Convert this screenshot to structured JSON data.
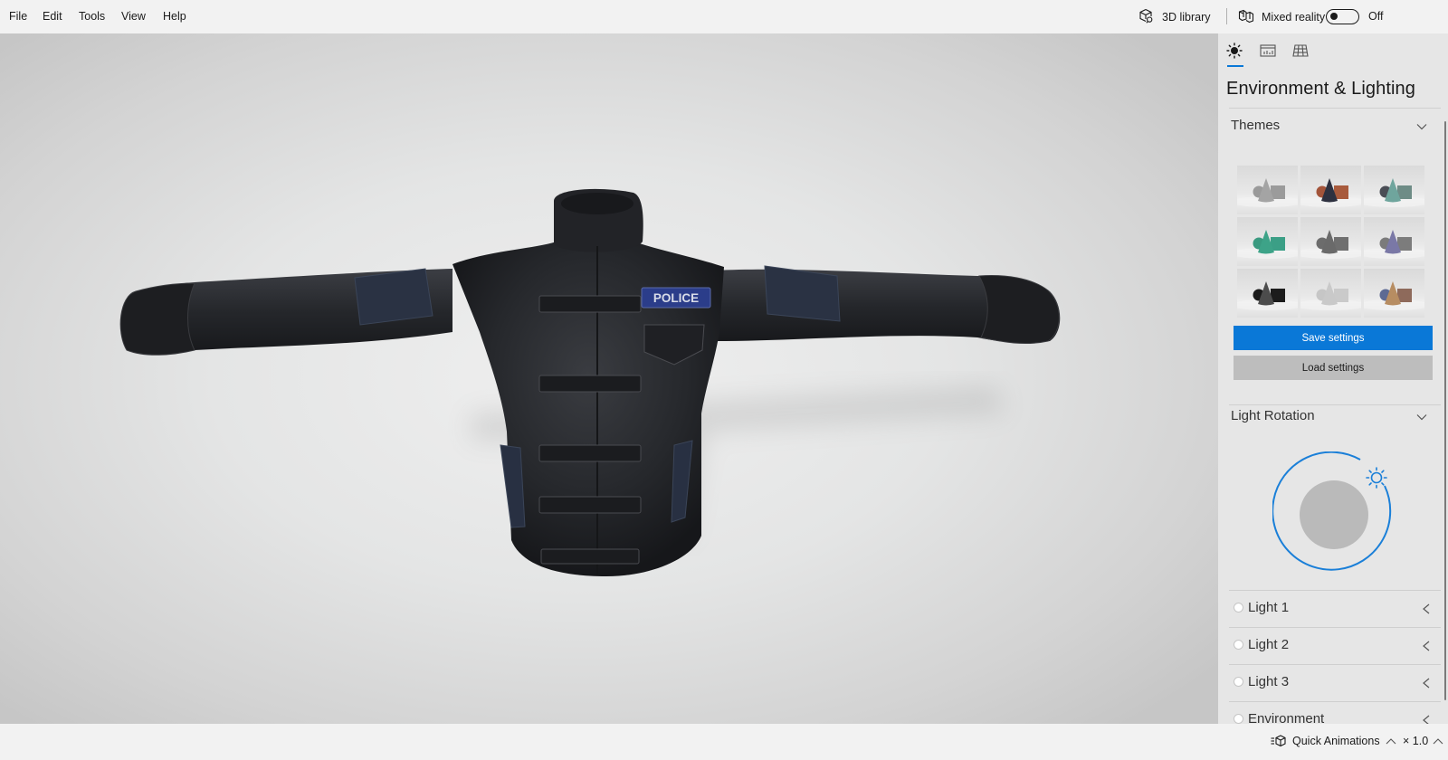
{
  "menu": {
    "items": [
      "File",
      "Edit",
      "Tools",
      "View",
      "Help"
    ]
  },
  "topbar": {
    "library_label": "3D library",
    "mixed_reality_label": "Mixed reality",
    "mixed_reality_state": "Off",
    "mixed_reality_on": false
  },
  "viewport": {
    "model_name": "police jacket",
    "badge_text": "POLICE"
  },
  "panel": {
    "tabs": [
      {
        "name": "environment-lighting",
        "icon": "sun-icon",
        "active": true
      },
      {
        "name": "stats-shading",
        "icon": "stats-icon",
        "active": false
      },
      {
        "name": "grid-views",
        "icon": "grid-icon",
        "active": false
      }
    ],
    "title": "Environment & Lighting",
    "themes": {
      "label": "Themes",
      "tiles": [
        {
          "name": "neutral-gray",
          "sphere": "#9a9a9a",
          "cone": "#a4a4a4",
          "box": "#9b9b9b"
        },
        {
          "name": "copper-navy",
          "sphere": "#a3543a",
          "cone": "#2e3140",
          "box": "#a85a3c"
        },
        {
          "name": "teal-slate",
          "sphere": "#4a4d55",
          "cone": "#6fa59d",
          "box": "#6e8c86"
        },
        {
          "name": "emerald",
          "sphere": "#3a9a80",
          "cone": "#3da388",
          "box": "#3b9f86"
        },
        {
          "name": "charcoal",
          "sphere": "#6c6c6c",
          "cone": "#6a6a6a",
          "box": "#6f6f6f"
        },
        {
          "name": "violet-gray",
          "sphere": "#7b7b7b",
          "cone": "#7a78a6",
          "box": "#7c7c7c"
        },
        {
          "name": "black",
          "sphere": "#1a1a1a",
          "cone": "#4c4c4c",
          "box": "#1c1c1c"
        },
        {
          "name": "light-silver",
          "sphere": "#c6c6c6",
          "cone": "#c9c9c9",
          "box": "#cacaca"
        },
        {
          "name": "multicolor",
          "sphere": "#5d6a93",
          "cone": "#b78d62",
          "box": "#8e6a5b"
        }
      ]
    },
    "save_label": "Save settings",
    "load_label": "Load settings",
    "light_rotation": {
      "label": "Light Rotation"
    },
    "lights": [
      {
        "label": "Light 1"
      },
      {
        "label": "Light 2"
      },
      {
        "label": "Light 3"
      },
      {
        "label": "Environment"
      }
    ]
  },
  "bottombar": {
    "quick_animations_label": "Quick Animations",
    "speed_label": "× 1.0"
  },
  "colors": {
    "accent": "#0a78d7",
    "panel_bg": "#e6e6e6",
    "chrome_bg": "#f2f2f2",
    "badge_blue": "#2b3d8a"
  }
}
